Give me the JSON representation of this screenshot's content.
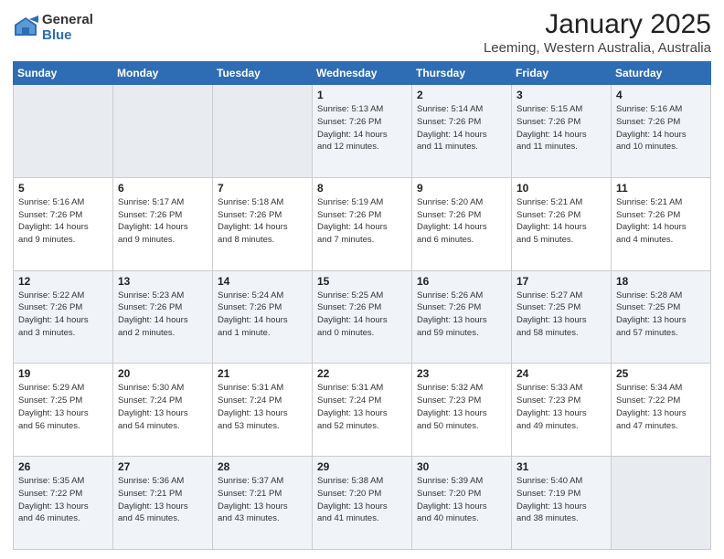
{
  "logo": {
    "general": "General",
    "blue": "Blue"
  },
  "title": "January 2025",
  "location": "Leeming, Western Australia, Australia",
  "headers": [
    "Sunday",
    "Monday",
    "Tuesday",
    "Wednesday",
    "Thursday",
    "Friday",
    "Saturday"
  ],
  "weeks": [
    [
      {
        "day": "",
        "text": ""
      },
      {
        "day": "",
        "text": ""
      },
      {
        "day": "",
        "text": ""
      },
      {
        "day": "1",
        "text": "Sunrise: 5:13 AM\nSunset: 7:26 PM\nDaylight: 14 hours\nand 12 minutes."
      },
      {
        "day": "2",
        "text": "Sunrise: 5:14 AM\nSunset: 7:26 PM\nDaylight: 14 hours\nand 11 minutes."
      },
      {
        "day": "3",
        "text": "Sunrise: 5:15 AM\nSunset: 7:26 PM\nDaylight: 14 hours\nand 11 minutes."
      },
      {
        "day": "4",
        "text": "Sunrise: 5:16 AM\nSunset: 7:26 PM\nDaylight: 14 hours\nand 10 minutes."
      }
    ],
    [
      {
        "day": "5",
        "text": "Sunrise: 5:16 AM\nSunset: 7:26 PM\nDaylight: 14 hours\nand 9 minutes."
      },
      {
        "day": "6",
        "text": "Sunrise: 5:17 AM\nSunset: 7:26 PM\nDaylight: 14 hours\nand 9 minutes."
      },
      {
        "day": "7",
        "text": "Sunrise: 5:18 AM\nSunset: 7:26 PM\nDaylight: 14 hours\nand 8 minutes."
      },
      {
        "day": "8",
        "text": "Sunrise: 5:19 AM\nSunset: 7:26 PM\nDaylight: 14 hours\nand 7 minutes."
      },
      {
        "day": "9",
        "text": "Sunrise: 5:20 AM\nSunset: 7:26 PM\nDaylight: 14 hours\nand 6 minutes."
      },
      {
        "day": "10",
        "text": "Sunrise: 5:21 AM\nSunset: 7:26 PM\nDaylight: 14 hours\nand 5 minutes."
      },
      {
        "day": "11",
        "text": "Sunrise: 5:21 AM\nSunset: 7:26 PM\nDaylight: 14 hours\nand 4 minutes."
      }
    ],
    [
      {
        "day": "12",
        "text": "Sunrise: 5:22 AM\nSunset: 7:26 PM\nDaylight: 14 hours\nand 3 minutes."
      },
      {
        "day": "13",
        "text": "Sunrise: 5:23 AM\nSunset: 7:26 PM\nDaylight: 14 hours\nand 2 minutes."
      },
      {
        "day": "14",
        "text": "Sunrise: 5:24 AM\nSunset: 7:26 PM\nDaylight: 14 hours\nand 1 minute."
      },
      {
        "day": "15",
        "text": "Sunrise: 5:25 AM\nSunset: 7:26 PM\nDaylight: 14 hours\nand 0 minutes."
      },
      {
        "day": "16",
        "text": "Sunrise: 5:26 AM\nSunset: 7:26 PM\nDaylight: 13 hours\nand 59 minutes."
      },
      {
        "day": "17",
        "text": "Sunrise: 5:27 AM\nSunset: 7:25 PM\nDaylight: 13 hours\nand 58 minutes."
      },
      {
        "day": "18",
        "text": "Sunrise: 5:28 AM\nSunset: 7:25 PM\nDaylight: 13 hours\nand 57 minutes."
      }
    ],
    [
      {
        "day": "19",
        "text": "Sunrise: 5:29 AM\nSunset: 7:25 PM\nDaylight: 13 hours\nand 56 minutes."
      },
      {
        "day": "20",
        "text": "Sunrise: 5:30 AM\nSunset: 7:24 PM\nDaylight: 13 hours\nand 54 minutes."
      },
      {
        "day": "21",
        "text": "Sunrise: 5:31 AM\nSunset: 7:24 PM\nDaylight: 13 hours\nand 53 minutes."
      },
      {
        "day": "22",
        "text": "Sunrise: 5:31 AM\nSunset: 7:24 PM\nDaylight: 13 hours\nand 52 minutes."
      },
      {
        "day": "23",
        "text": "Sunrise: 5:32 AM\nSunset: 7:23 PM\nDaylight: 13 hours\nand 50 minutes."
      },
      {
        "day": "24",
        "text": "Sunrise: 5:33 AM\nSunset: 7:23 PM\nDaylight: 13 hours\nand 49 minutes."
      },
      {
        "day": "25",
        "text": "Sunrise: 5:34 AM\nSunset: 7:22 PM\nDaylight: 13 hours\nand 47 minutes."
      }
    ],
    [
      {
        "day": "26",
        "text": "Sunrise: 5:35 AM\nSunset: 7:22 PM\nDaylight: 13 hours\nand 46 minutes."
      },
      {
        "day": "27",
        "text": "Sunrise: 5:36 AM\nSunset: 7:21 PM\nDaylight: 13 hours\nand 45 minutes."
      },
      {
        "day": "28",
        "text": "Sunrise: 5:37 AM\nSunset: 7:21 PM\nDaylight: 13 hours\nand 43 minutes."
      },
      {
        "day": "29",
        "text": "Sunrise: 5:38 AM\nSunset: 7:20 PM\nDaylight: 13 hours\nand 41 minutes."
      },
      {
        "day": "30",
        "text": "Sunrise: 5:39 AM\nSunset: 7:20 PM\nDaylight: 13 hours\nand 40 minutes."
      },
      {
        "day": "31",
        "text": "Sunrise: 5:40 AM\nSunset: 7:19 PM\nDaylight: 13 hours\nand 38 minutes."
      },
      {
        "day": "",
        "text": ""
      }
    ]
  ]
}
